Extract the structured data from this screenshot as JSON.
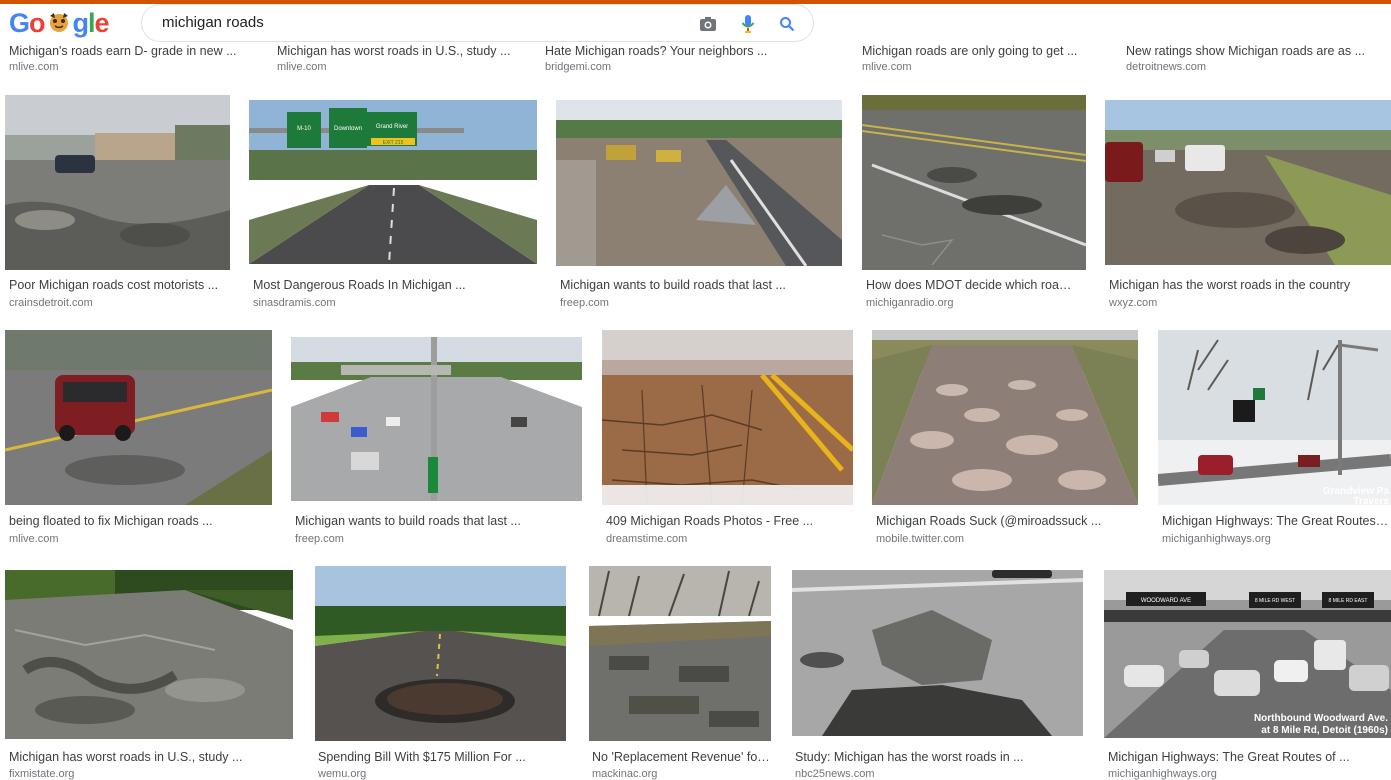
{
  "search": {
    "query": "michigan roads"
  },
  "logo": {
    "letters": [
      "G",
      "o",
      "o",
      "g",
      "l",
      "e"
    ],
    "colors": [
      "#4285f4",
      "#ea4335",
      "#fbbc05",
      "#4285f4",
      "#34a853",
      "#ea4335"
    ]
  },
  "top_row": [
    {
      "title": "Michigan's roads earn D- grade in new ...",
      "source": "mlive.com"
    },
    {
      "title": "Michigan has worst roads in U.S., study ...",
      "source": "mlive.com"
    },
    {
      "title": "Hate Michigan roads? Your neighbors ...",
      "source": "bridgemi.com"
    },
    {
      "title": "Michigan roads are only going to get ...",
      "source": "mlive.com"
    },
    {
      "title": "New ratings show Michigan roads are as ...",
      "source": "detroitnews.com"
    }
  ],
  "row1": [
    {
      "title": "Poor Michigan roads cost motorists ...",
      "source": "crainsdetroit.com",
      "image": "pothole-road-with-car"
    },
    {
      "title": "Most Dangerous Roads In Michigan ...",
      "source": "sinasdramis.com",
      "image": "highway-signs"
    },
    {
      "title": "Michigan wants to build roads that last ...",
      "source": "freep.com",
      "image": "road-construction"
    },
    {
      "title": "How does MDOT decide which roads t...",
      "source": "michiganradio.org",
      "image": "cracked-road"
    },
    {
      "title": "Michigan has the worst roads in the country",
      "source": "wxyz.com",
      "image": "damaged-road-with-truck"
    }
  ],
  "row2": [
    {
      "title": "being floated to fix Michigan roads ...",
      "source": "mlive.com",
      "image": "red-suv-on-road"
    },
    {
      "title": "Michigan wants to build roads that last ...",
      "source": "freep.com",
      "image": "freeway-traffic"
    },
    {
      "title": "409 Michigan Roads Photos - Free ...",
      "source": "dreamstime.com",
      "image": "cracked-rural-road"
    },
    {
      "title": "Michigan Roads Suck (@miroadssuck ...",
      "source": "mobile.twitter.com",
      "image": "pothole-field-road"
    },
    {
      "title": "Michigan Highways: The Great Routes of ...",
      "source": "michiganhighways.org",
      "image": "winter-highway"
    }
  ],
  "row2_overlay": {
    "line1": "Grandview Pa",
    "line2": "Travers"
  },
  "row3": [
    {
      "title": "Michigan has worst roads in U.S., study ...",
      "source": "fixmistate.org",
      "image": "broken-asphalt"
    },
    {
      "title": "Spending Bill With $175 Million For ...",
      "source": "wemu.org",
      "image": "single-pothole-road"
    },
    {
      "title": "No 'Replacement Revenue' for ...",
      "source": "mackinac.org",
      "image": "patched-rural-road"
    },
    {
      "title": "Study: Michigan has the worst roads in ...",
      "source": "nbc25news.com",
      "image": "pothole-closeup"
    },
    {
      "title": "Michigan Highways: The Great Routes of ...",
      "source": "michiganhighways.org",
      "image": "vintage-woodward-ave"
    }
  ],
  "row3_overlay": {
    "line1": "Northbound Woodward Ave.",
    "line2": "at 8 Mile Rd, Detoit (1960s)",
    "sign1": "WOODWARD AVE",
    "sign2": "8 MILE RD WEST",
    "sign3": "8 MILE RD EAST"
  },
  "sign_text": {
    "a": "M-10",
    "b": "Downtown",
    "c": "Grand River",
    "d": "EXIT 215"
  },
  "colors": {
    "accent_bar": "#d35400",
    "title_text": "#3c4043",
    "source_text": "#70757a",
    "search_icon": "#4285f4"
  }
}
